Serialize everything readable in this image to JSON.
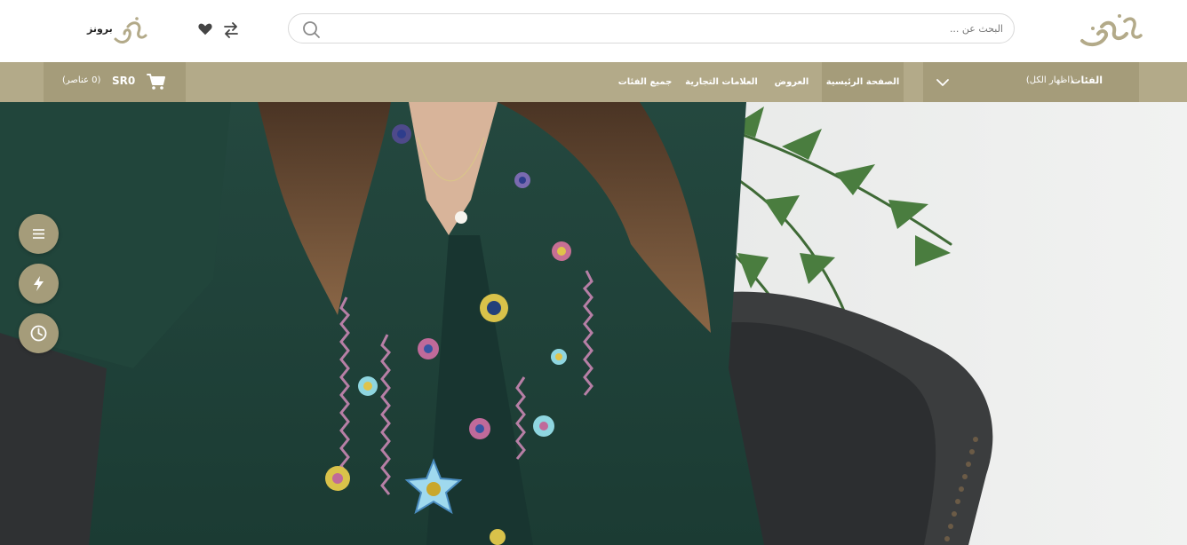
{
  "header": {
    "logo_name": "arabic-calligraphy-logo",
    "search_placeholder": "البحث عن ...",
    "brand_text": "برونز"
  },
  "nav": {
    "categories_label": "الفئات",
    "show_all_label": "(اظهار الكل)",
    "links": [
      {
        "label": "الصفحة الرئيسية",
        "active": true
      },
      {
        "label": "العروض",
        "active": false
      },
      {
        "label": "العلامات التجارية",
        "active": false
      },
      {
        "label": "جميع الفئات",
        "active": false
      }
    ],
    "cart": {
      "total": "SR0",
      "items": "(0 عناصر)"
    }
  },
  "floating_buttons": [
    "menu-icon",
    "bolt-icon",
    "clock-icon"
  ],
  "colors": {
    "accent": "#b3aa89",
    "accent_dark": "#a59c7a",
    "hero_green": "#1f4339"
  }
}
